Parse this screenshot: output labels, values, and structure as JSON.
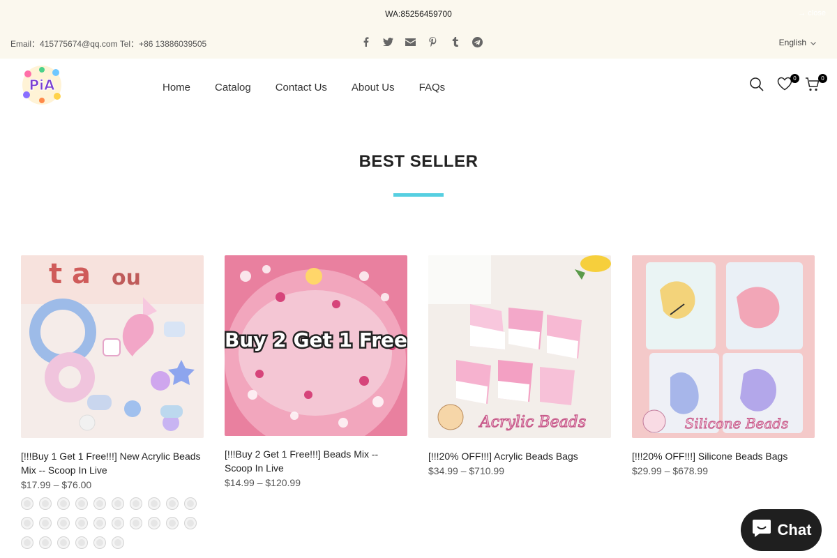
{
  "topbar": {
    "wa": "WA:85256459700",
    "close": "→ close",
    "contact": "Email：415775674@qq.com Tel：+86 13886039505",
    "language": "English"
  },
  "nav": {
    "items": [
      "Home",
      "Catalog",
      "Contact Us",
      "About Us",
      "FAQs"
    ]
  },
  "header": {
    "wishlist_count": "0",
    "cart_count": "0",
    "logo_text": "PiA"
  },
  "section": {
    "title": "BEST SELLER"
  },
  "products": [
    {
      "name": "[!!!Buy 1 Get 1 Free!!!] New Acrylic Beads Mix -- Scoop In Live",
      "price": "$17.99 – $76.00"
    },
    {
      "name": "[!!!Buy 2 Get 1 Free!!!] Beads Mix -- Scoop In Live",
      "price": "$14.99 – $120.99",
      "banner": "Buy 2 Get 1 Free"
    },
    {
      "name": "[!!!20% OFF!!!] Acrylic Beads Bags",
      "price": "$34.99 – $710.99",
      "banner": "Acrylic Beads"
    },
    {
      "name": "[!!!20% OFF!!!] Silicone Beads Bags",
      "price": "$29.99 – $678.99",
      "banner": "Silicone Beads"
    }
  ],
  "swatch_count": 26,
  "chat": {
    "label": "Chat"
  },
  "colors": {
    "accent": "#56cfe1",
    "topbar_bg": "#fbf8ee",
    "chat_bg": "#1f1f1f"
  }
}
